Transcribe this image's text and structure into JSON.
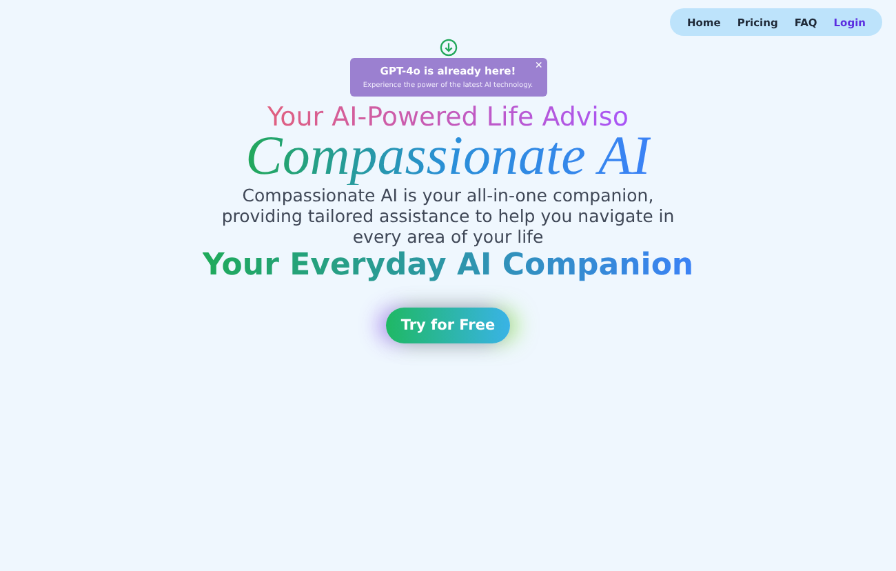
{
  "nav": {
    "links": [
      {
        "label": "Home",
        "selected": false
      },
      {
        "label": "Pricing",
        "selected": false
      },
      {
        "label": "FAQ",
        "selected": false
      },
      {
        "label": "Login",
        "selected": true
      }
    ]
  },
  "announcement": {
    "title": "GPT-4o is already here!",
    "message": "Experience the power of the latest AI technology.",
    "close": "×"
  },
  "hero": {
    "tagline": "Your AI-Powered Life Adviso",
    "title": "Compassionate AI",
    "description": "Compassionate AI is your all-in-one companion, providing tailored assistance to help you navigate in every area of your life",
    "subtitle": "Your Everyday AI Companion",
    "cta": "Try for Free"
  }
}
